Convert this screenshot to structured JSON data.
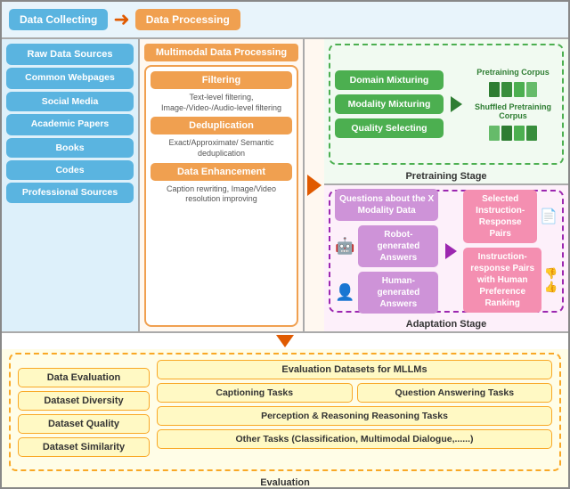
{
  "header": {
    "data_collecting": "Data Collecting",
    "data_processing": "Data Processing"
  },
  "left": {
    "label": "Raw Data Sources",
    "items": [
      "Raw Data Sources",
      "Common Webpages",
      "Social Media",
      "Academic Papers",
      "Books",
      "Codes",
      "Professional Sources"
    ]
  },
  "middle": {
    "label": "Multimodal Data Processing",
    "steps": [
      {
        "title": "Filtering",
        "desc": "Text-level filtering, Image-/Video-/Audio-level filtering"
      },
      {
        "title": "Deduplication",
        "desc": "Exact/Approximate/ Semantic deduplication"
      },
      {
        "title": "Data Enhancement",
        "desc": "Caption rewriting, Image/Video resolution improving"
      }
    ]
  },
  "pretraining": {
    "stage_label": "Pretraining Stage",
    "steps": [
      "Domain Mixturing",
      "Modality Mixturing",
      "Quality Selecting"
    ],
    "corpus1": "Pretraining Corpus",
    "corpus2": "Shuffled Pretraining Corpus"
  },
  "adaptation": {
    "stage_label": "Adaptation Stage",
    "questions": "Questions about the X Modality Data",
    "robot": "Robot-generated Answers",
    "human": "Human-generated Answers",
    "selected": "Selected Instruction-Response Pairs",
    "ranked": "Instruction-response Pairs with Human Preference Ranking"
  },
  "evaluation": {
    "stage_label": "Evaluation",
    "left_items": [
      "Data Evaluation",
      "Dataset Diversity",
      "Dataset Quality",
      "Dataset Similarity"
    ],
    "right_header": "Evaluation Datasets for MLLMs",
    "right_items": [
      [
        "Captioning Tasks",
        "Question Answering Tasks"
      ],
      [
        "Perception & Reasoning Reasoning Tasks"
      ],
      [
        "Other Tasks (Classification, Multimodal Dialogue,......)"
      ]
    ]
  }
}
